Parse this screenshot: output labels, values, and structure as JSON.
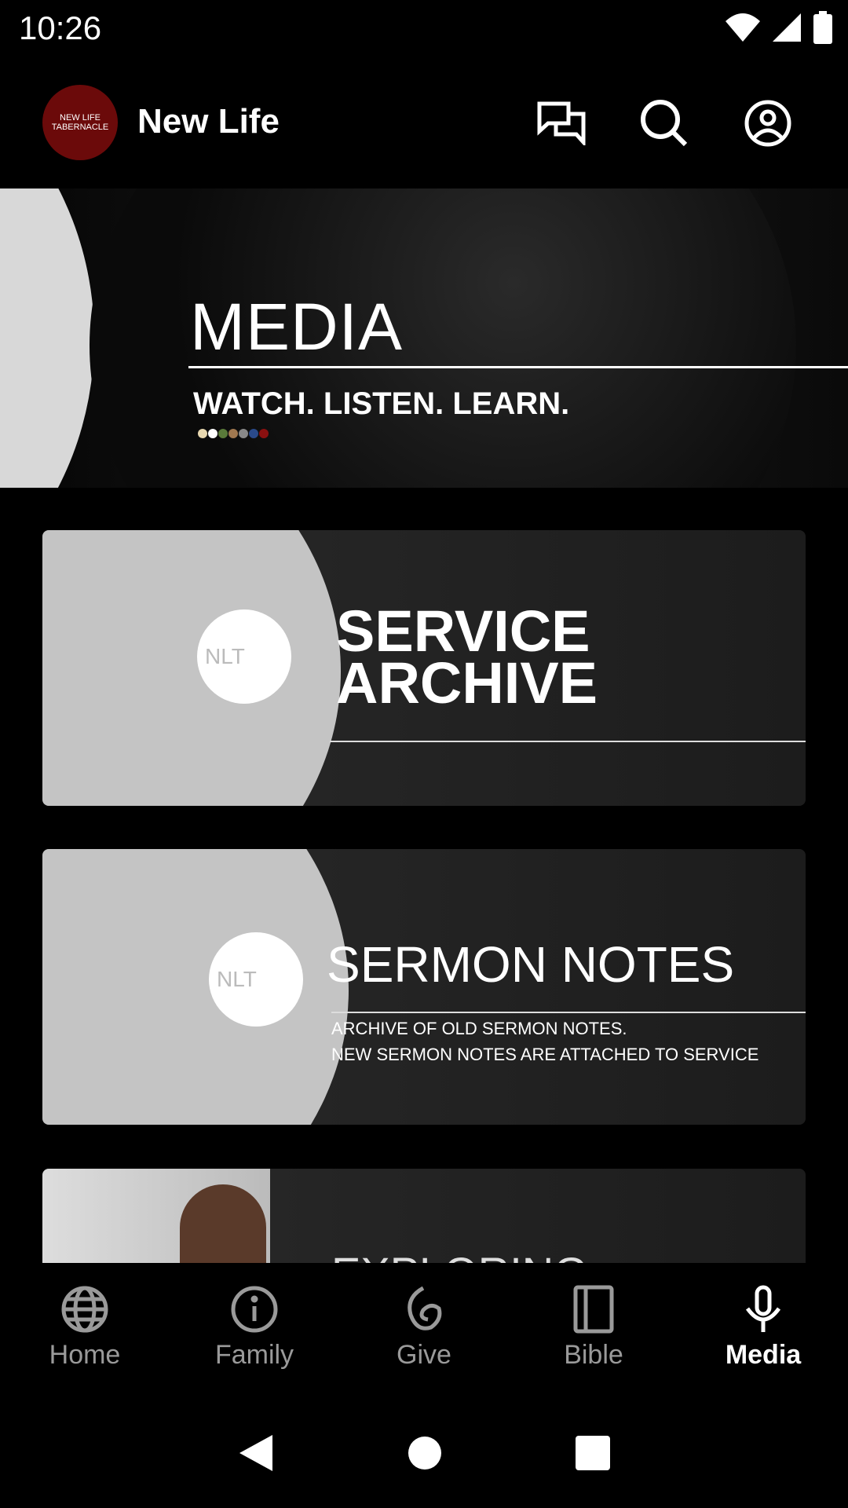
{
  "status_bar": {
    "time": "10:26"
  },
  "app_bar": {
    "logo_text": [
      "NEW LIFE",
      "TABERNACLE"
    ],
    "title": "New Life"
  },
  "banner": {
    "title": "MEDIA",
    "subtitle": "WATCH. LISTEN. LEARN.",
    "dot_colors": [
      "#e8d8b0",
      "#ffffff",
      "#5a7a3a",
      "#a07850",
      "#888888",
      "#2a4a8a",
      "#8a1010"
    ]
  },
  "cards": [
    {
      "logo": "NLT",
      "title_lines": [
        "SERVICE",
        "ARCHIVE"
      ]
    },
    {
      "logo": "NLT",
      "title": "SERMON NOTES",
      "desc_lines": [
        "ARCHIVE OF OLD SERMON NOTES.",
        "NEW SERMON NOTES ARE ATTACHED TO SERVICE"
      ]
    },
    {
      "title": "EXPLORING"
    }
  ],
  "bottom_nav": [
    {
      "label": "Home",
      "icon": "globe-icon"
    },
    {
      "label": "Family",
      "icon": "info-icon"
    },
    {
      "label": "Give",
      "icon": "give-icon"
    },
    {
      "label": "Bible",
      "icon": "book-icon"
    },
    {
      "label": "Media",
      "icon": "microphone-icon",
      "active": true
    }
  ]
}
